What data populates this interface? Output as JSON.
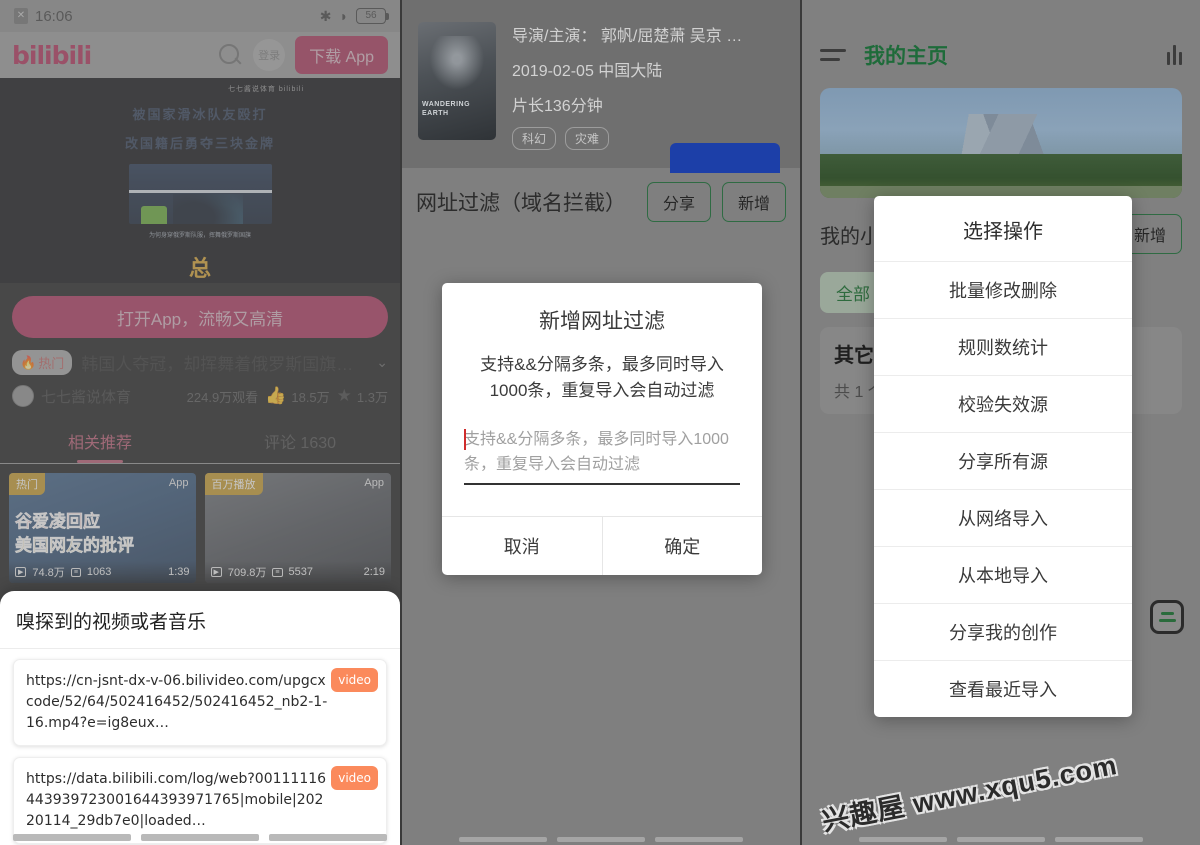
{
  "watermark": {
    "text": "兴趣屋 www.xqu5.com"
  },
  "panel_bilibili": {
    "statusbar": {
      "bluetooth_icon": "bluetooth-icon",
      "time": "16:06",
      "wifi_icon": "wifi-icon",
      "battery": "56"
    },
    "topbar": {
      "logo": "bilibili",
      "search_icon": "search-icon",
      "login_label": "登录",
      "download_app_label": "下载 App"
    },
    "video": {
      "watermark": "七七酱说体育 bilibili",
      "overlay_title_line1": "被国家滑冰队友殴打",
      "overlay_title_line2": "改国籍后勇夺三块金牌",
      "frame_caption": "为何身穿俄罗斯队服，挥舞俄罗斯国旗",
      "logo_char": "总"
    },
    "open_app_banner": "打开App，流畅又高清",
    "title_row": {
      "hot_badge": "热门",
      "title": "韩国人夺冠，却挥舞着俄罗斯国旗…",
      "chevron_icon": "chevron-down-icon"
    },
    "meta_row": {
      "avatar": "avatar",
      "up_name": "七七酱说体育",
      "views": "224.9万观看",
      "like_icon": "thumbs-up-icon",
      "likes": "18.5万",
      "star_icon": "star-icon",
      "favorites": "1.3万"
    },
    "tabs": [
      {
        "label": "相关推荐",
        "active": true
      },
      {
        "label": "评论 1630",
        "active": false
      }
    ],
    "cards": [
      {
        "tag": "热门",
        "app": "App",
        "text1": "谷爱凌回应",
        "text2": "美国网友的批评",
        "plays": "74.8万",
        "comments": "1063",
        "duration": "1:39"
      },
      {
        "tag": "百万播放",
        "app": "App",
        "text1": "",
        "text2": "",
        "plays": "709.8万",
        "comments": "5537",
        "duration": "2:19"
      }
    ],
    "sniffer": {
      "title": "嗅探到的视频或者音乐",
      "items": [
        {
          "url": "https://cn-jsnt-dx-v-06.bilivideo.com/upgcxcode/52/64/502416452/502416452_nb2-1-16.mp4?e=ig8eux…",
          "tag": "video"
        },
        {
          "url": "https://data.bilibili.com/log/web?00111116443939723001644393971765|mobile|20220114_29db7e0|loaded…",
          "tag": "video"
        }
      ]
    }
  },
  "panel_filter": {
    "movie": {
      "poster_text": "WANDERING EARTH",
      "director_cast": "导演/主演：  郭帆/屈楚萧 吴京 …",
      "release": "2019-02-05  中国大陆",
      "duration": "片长136分钟",
      "tags": [
        "科幻",
        "灾难"
      ]
    },
    "header": {
      "title": "网址过滤（域名拦截）",
      "share_label": "分享",
      "add_label": "新增"
    },
    "dialog": {
      "title": "新增网址过滤",
      "subtitle": "支持&&分隔多条，最多同时导入1000条，重复导入会自动过滤",
      "input_value": "",
      "input_placeholder": "支持&&分隔多条，最多同时导入1000条，重复导入会自动过滤",
      "cancel_label": "取消",
      "confirm_label": "确定"
    }
  },
  "panel_home": {
    "appbar": {
      "menu_icon": "hamburger-menu-icon",
      "title": "我的主页",
      "bars_icon": "equalizer-icon"
    },
    "list_header": {
      "title": "我的小…",
      "add_label": "新增"
    },
    "filter_chip": "全部",
    "group": {
      "name": "其它",
      "count": "共 1 个"
    },
    "fab_icon": "list-fab-icon",
    "dialog": {
      "title": "选择操作",
      "items": [
        "批量修改删除",
        "规则数统计",
        "校验失效源",
        "分享所有源",
        "从网络导入",
        "从本地导入",
        "分享我的创作",
        "查看最近导入"
      ]
    }
  }
}
